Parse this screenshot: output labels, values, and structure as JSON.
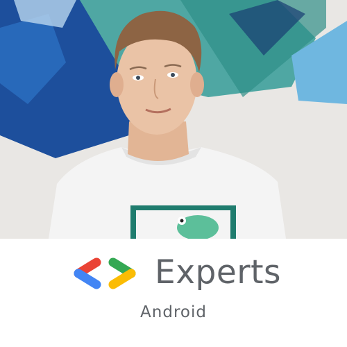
{
  "badge": {
    "program_name": "Experts",
    "specialty": "Android"
  },
  "colors": {
    "logo_red": "#ea4335",
    "logo_blue": "#4285f4",
    "logo_green": "#34a853",
    "logo_yellow": "#fbbc04",
    "text_gray": "#5f6368",
    "mural_blue": "#1d4f9c",
    "mural_teal": "#4fa7a3",
    "shirt": "#f4f4f4",
    "shirt_print": "#1f7c6e"
  },
  "photo": {
    "subject": "portrait-of-person",
    "background": "blue-teal-mural"
  }
}
